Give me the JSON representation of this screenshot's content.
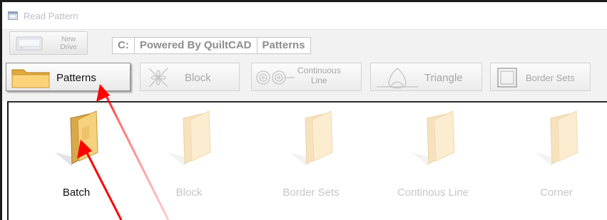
{
  "window": {
    "title": "Read Pattern"
  },
  "toolbar": {
    "new_drive_label_line1": "New",
    "new_drive_label_line2": "Drive",
    "path": [
      "C:",
      "Powered By QuiltCAD",
      "Patterns"
    ]
  },
  "tabs": [
    {
      "label": "Patterns",
      "active": true
    },
    {
      "label": "Block",
      "active": false
    },
    {
      "label_line1": "Continuous",
      "label_line2": "Line",
      "active": false
    },
    {
      "label": "Triangle",
      "active": false
    },
    {
      "label": "Border Sets",
      "active": false
    }
  ],
  "folders": [
    {
      "label": "Batch",
      "enabled": true
    },
    {
      "label": "Block",
      "enabled": false
    },
    {
      "label": "Border Sets",
      "enabled": false
    },
    {
      "label": "Continous Line",
      "enabled": false
    },
    {
      "label": "Corner",
      "enabled": false
    }
  ],
  "colors": {
    "annotation_arrow": "#ff0000",
    "folder_enabled": "#f2c56e",
    "folder_disabled": "#fbe8c8"
  }
}
